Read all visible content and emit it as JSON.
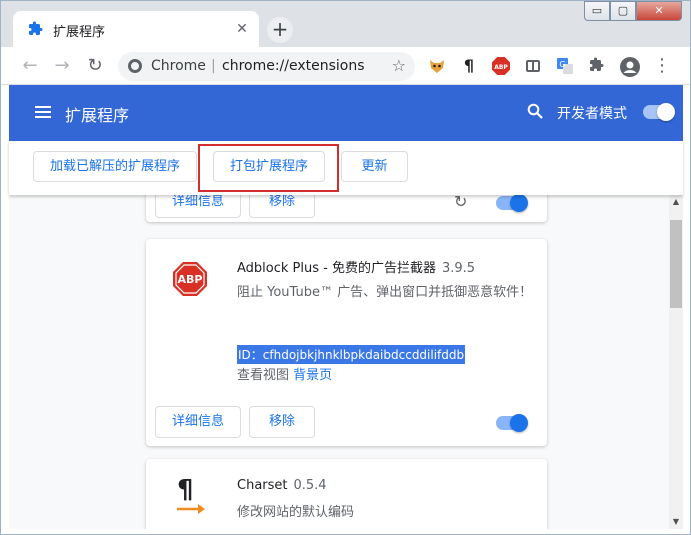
{
  "window": {
    "controls": {
      "minimize": "▭",
      "maximize": "▢",
      "close": "✕"
    }
  },
  "tab": {
    "title": "扩展程序",
    "close": "✕",
    "new_tab": "+"
  },
  "toolbar": {
    "back": "←",
    "forward": "→",
    "reload": "↻",
    "url_scheme": "Chrome",
    "url_separator": "|",
    "url": "chrome://extensions",
    "bookmark": "☆",
    "menu": "⋮"
  },
  "extensions_header": {
    "title": "扩展程序",
    "developer_mode_label": "开发者模式",
    "developer_mode_on": true
  },
  "actions": {
    "load_unpacked": "加载已解压的扩展程序",
    "pack": "打包扩展程序",
    "update": "更新"
  },
  "cards": [
    {
      "details": "详细信息",
      "remove": "移除",
      "reload": "↻",
      "enabled": true
    },
    {
      "icon_text": "ABP",
      "name": "Adblock Plus - 免费的广告拦截器",
      "version": "3.9.5",
      "description": "阻止 YouTube™ 广告、弹出窗口并抵御恶意软件！",
      "id": "ID：cfhdojbkjhnklbpkdaibdccddilifddb",
      "inspect_label": "查看视图",
      "background_page": "背景页",
      "details": "详细信息",
      "remove": "移除",
      "enabled": true
    },
    {
      "icon_text": "¶",
      "name": "Charset",
      "version": "0.5.4",
      "description": "修改网站的默认编码"
    }
  ],
  "colors": {
    "header_blue": "#3367d6",
    "accent": "#1a73e8",
    "highlight_red": "#d32f2f",
    "abp_red": "#d93025"
  }
}
